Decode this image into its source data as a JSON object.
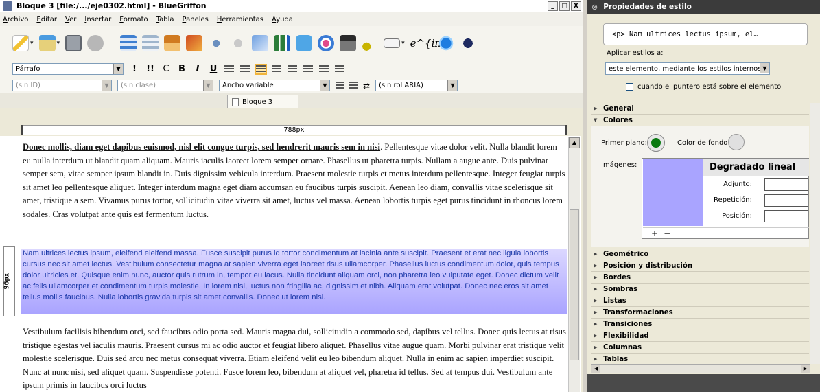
{
  "window": {
    "title": "Bloque 3 [file:/.../eje0302.html] - BlueGriffon",
    "controls": [
      "_",
      "□",
      "X"
    ]
  },
  "menu": [
    "Archivo",
    "Editar",
    "Ver",
    "Insertar",
    "Formato",
    "Tabla",
    "Paneles",
    "Herramientas",
    "Ayuda"
  ],
  "toolbar": {
    "math_label": "e^{iπ}"
  },
  "format": {
    "paragraph_style": "Párrafo",
    "buttons": [
      "!",
      "!!",
      "C",
      "B",
      "I",
      "U"
    ]
  },
  "attrs": {
    "id": "(sin ID)",
    "class": "(sin clase)",
    "width": "Ancho variable",
    "aria": "(sin rol ARIA)"
  },
  "tabs": [
    {
      "label": "Bloque 3"
    }
  ],
  "ruler": {
    "width_label": "788px",
    "height_label": "96px"
  },
  "document": {
    "p1_lead": "Donec mollis, diam eget dapibus euismod, nisl elit congue turpis, sed hendrerit mauris sem in nisi",
    "p1_rest": ". Pellentesque vitae dolor velit. Nulla blandit lorem eu nulla interdum ut blandit quam aliquam. Mauris iaculis laoreet lorem semper ornare. Phasellus ut pharetra turpis. Nullam a augue ante. Duis pulvinar semper sem, vitae semper ipsum blandit in. Duis dignissim vehicula interdum. Praesent molestie turpis et metus interdum pellentesque. Integer feugiat turpis sit amet leo pellentesque aliquet. Integer interdum magna eget diam accumsan eu faucibus turpis suscipit. Aenean leo diam, convallis vitae scelerisque sit amet, tristique a sem. Vivamus purus tortor, sollicitudin vitae viverra sit amet, luctus vel massa. Aenean lobortis turpis eget purus tincidunt in rhoncus lorem sodales. Cras volutpat ante quis est fermentum luctus.",
    "p2": "Nam ultrices lectus ipsum, eleifend eleifend massa. Fusce suscipit purus id tortor condimentum at lacinia ante suscipit. Praesent et erat nec ligula lobortis cursus nec sit amet lectus. Vestibulum consectetur magna at sapien viverra eget laoreet risus ullamcorper. Phasellus luctus condimentum dolor, quis tempus dolor ultricies et. Quisque enim nunc, auctor quis rutrum in, tempor eu lacus. Nulla tincidunt aliquam orci, non pharetra leo vulputate eget. Donec dictum velit ac felis ullamcorper et condimentum turpis molestie. In lorem nisl, luctus non fringilla ac, dignissim et nibh. Aliquam erat volutpat. Donec nec eros sit amet tellus mollis faucibus. Nulla lobortis gravida turpis sit amet convallis. Donec ut lorem nisl.",
    "p3": "Vestibulum facilisis bibendum orci, sed faucibus odio porta sed. Mauris magna dui, sollicitudin a commodo sed, dapibus vel tellus. Donec quis lectus at risus tristique egestas vel iaculis mauris. Praesent cursus mi ac odio auctor et feugiat libero aliquet. Phasellus vitae augue quam. Morbi pulvinar erat tristique velit molestie scelerisque. Duis sed arcu nec metus consequat viverra. Etiam eleifend velit eu leo bibendum aliquet. Nulla in enim ac sapien imperdiet suscipit. Nunc at nunc nisi, sed aliquet quam. Suspendisse potenti. Fusce lorem leo, bibendum at aliquet vel, pharetra id tellus. Sed at tempus dui. Vestibulum ante ipsum primis in faucibus orci luctus"
  },
  "panel": {
    "title": "Propiedades de estilo",
    "selector": "<p> Nam ultrices lectus ipsum, el…",
    "apply_label": "Aplicar estilos a:",
    "apply_value": "este elemento, mediante los estilos internos",
    "hover_label": "cuando el puntero está sobre el elemento",
    "sections_top": [
      "General",
      "Colores"
    ],
    "colors": {
      "fg_label": "Primer plano:",
      "fg_color": "#0b7a12",
      "bg_label": "Color de fondo:",
      "images_label": "Imágenes:",
      "gradient_title": "Degradado lineal",
      "fields": [
        "Adjunto:",
        "Repetición:",
        "Posición:"
      ],
      "add": "+",
      "remove": "−"
    },
    "sections_bottom": [
      "Geométrico",
      "Posición y distribución",
      "Bordes",
      "Sombras",
      "Listas",
      "Transformaciones",
      "Transiciones",
      "Flexibilidad",
      "Columnas",
      "Tablas"
    ]
  }
}
